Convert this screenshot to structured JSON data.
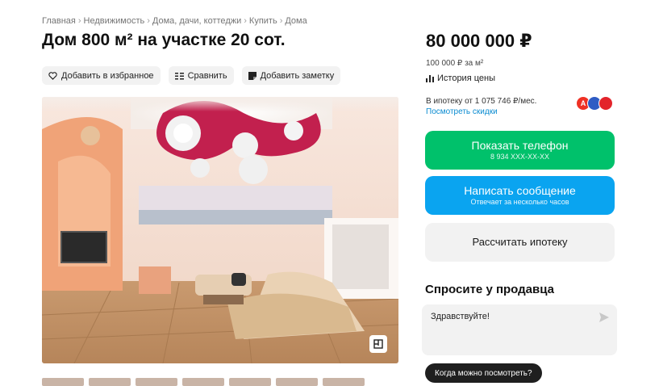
{
  "breadcrumb": [
    "Главная",
    "Недвижимость",
    "Дома, дачи, коттеджи",
    "Купить",
    "Дома"
  ],
  "title": "Дом 800 м² на участке 20 сот.",
  "actions": {
    "favorite": "Добавить в избранное",
    "compare": "Сравнить",
    "note": "Добавить заметку"
  },
  "price": {
    "total": "80 000 000 ₽",
    "per_m2": "100 000 ₽ за м²",
    "history": "История цены"
  },
  "mortgage": {
    "text": "В ипотеку от 1 075 746 ₽/мес.",
    "link": "Посмотреть скидки",
    "banks": [
      {
        "letter": "А",
        "color": "#ef3124"
      },
      {
        "letter": "",
        "color": "#2f5cc4"
      },
      {
        "letter": "",
        "color": "#e3242b"
      }
    ]
  },
  "buttons": {
    "phone": "Показать телефон",
    "phone_number": "8 934 XXX-XX-XX",
    "message": "Написать сообщение",
    "message_sub": "Отвечает за несколько часов",
    "calc": "Рассчитать ипотеку"
  },
  "seller": {
    "title": "Спросите у продавца",
    "message_value": "Здравствуйте!",
    "quick_reply": "Когда можно посмотреть?"
  },
  "colors": {
    "green": "#00c16b",
    "blue": "#0aa4f0",
    "link": "#0a8bd1"
  }
}
